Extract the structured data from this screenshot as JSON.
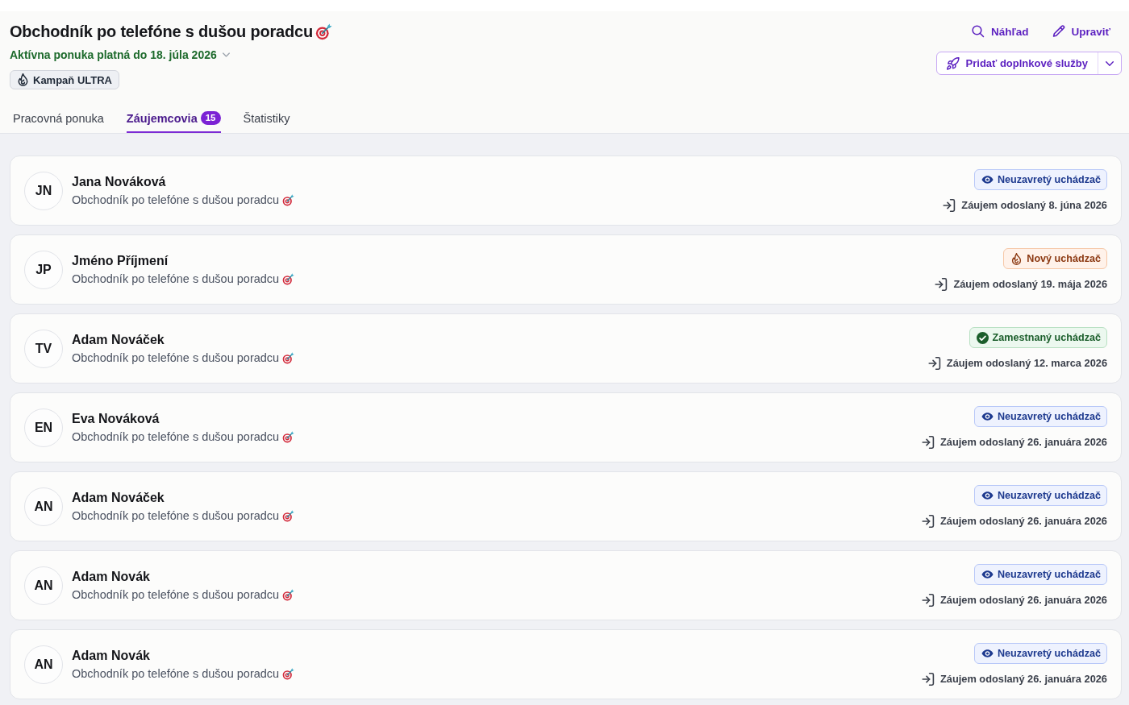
{
  "header": {
    "title": "Obchodník po telefóne s dušou poradcu",
    "offer_status": "Aktívna ponuka platná do 18. júla 2026",
    "campaign_tag": "Kampaň ULTRA",
    "actions": [
      {
        "kind": "preview",
        "label": "Náhľad"
      },
      {
        "kind": "edit",
        "label": "Upraviť"
      }
    ],
    "split_button": {
      "label": "Pridať doplnkové služby"
    }
  },
  "tabs": [
    {
      "label": "Pracovná ponuka",
      "selected": false
    },
    {
      "label": "Záujemcovia",
      "selected": true,
      "count": "15"
    },
    {
      "label": "Štatistiky",
      "selected": false
    }
  ],
  "applicants": [
    {
      "initials": "JN",
      "name": "Jana Nováková",
      "position": "Obchodník po telefóne s dušou poradcu",
      "status": {
        "kind": "open",
        "label": "Neuzavretý uchádzač"
      },
      "submitted": "Záujem odoslaný 8. júna 2026"
    },
    {
      "initials": "JP",
      "name": "Jméno Příjmení",
      "position": "Obchodník po telefóne s dušou poradcu",
      "status": {
        "kind": "new",
        "label": "Nový uchádzač"
      },
      "submitted": "Záujem odoslaný 19. mája 2026"
    },
    {
      "initials": "TV",
      "name": "Adam Nováček",
      "position": "Obchodník po telefóne s dušou poradcu",
      "status": {
        "kind": "employed",
        "label": "Zamestnaný uchádzač"
      },
      "submitted": "Záujem odoslaný 12. marca 2026"
    },
    {
      "initials": "EN",
      "name": "Eva Nováková",
      "position": "Obchodník po telefóne s dušou poradcu",
      "status": {
        "kind": "open",
        "label": "Neuzavretý uchádzač"
      },
      "submitted": "Záujem odoslaný 26. januára 2026"
    },
    {
      "initials": "AN",
      "name": "Adam Nováček",
      "position": "Obchodník po telefóne s dušou poradcu",
      "status": {
        "kind": "open",
        "label": "Neuzavretý uchádzač"
      },
      "submitted": "Záujem odoslaný 26. januára 2026"
    },
    {
      "initials": "AN",
      "name": "Adam Novák",
      "position": "Obchodník po telefóne s dušou poradcu",
      "status": {
        "kind": "open",
        "label": "Neuzavretý uchádzač"
      },
      "submitted": "Záujem odoslaný 26. januára 2026"
    },
    {
      "initials": "AN",
      "name": "Adam Novák",
      "position": "Obchodník po telefóne s dušou poradcu",
      "status": {
        "kind": "open",
        "label": "Neuzavretý uchádzač"
      },
      "submitted": "Záujem odoslaný 26. januára 2026"
    }
  ]
}
